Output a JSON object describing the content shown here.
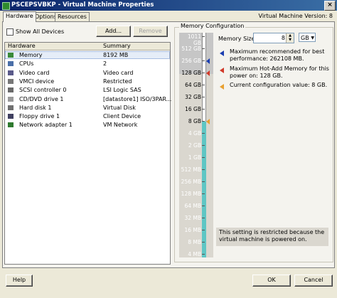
{
  "window": {
    "title": "PSCEPSVBKP - Virtual Machine Properties",
    "close_glyph": "×"
  },
  "tabs": [
    {
      "label": "Hardware"
    },
    {
      "label": "Options"
    },
    {
      "label": "Resources"
    }
  ],
  "version_label": "Virtual Machine Version: 8",
  "hardware": {
    "show_all_devices_label": "Show All Devices",
    "add_label": "Add...",
    "remove_label": "Remove",
    "columns": [
      "Hardware",
      "Summary"
    ],
    "rows": [
      {
        "name": "Memory",
        "summary": "8192 MB",
        "icon": "memory-icon",
        "selected": true
      },
      {
        "name": "CPUs",
        "summary": "2",
        "icon": "cpu-icon"
      },
      {
        "name": "Video card",
        "summary": "Video card",
        "icon": "video-card-icon"
      },
      {
        "name": "VMCI device",
        "summary": "Restricted",
        "icon": "vmci-icon"
      },
      {
        "name": "SCSI controller 0",
        "summary": "LSI Logic SAS",
        "icon": "scsi-icon"
      },
      {
        "name": "CD/DVD drive 1",
        "summary": "[datastore1] ISO/3PAR...",
        "icon": "cd-dvd-icon"
      },
      {
        "name": "Hard disk 1",
        "summary": "Virtual Disk",
        "icon": "hard-disk-icon"
      },
      {
        "name": "Floppy drive 1",
        "summary": "Client Device",
        "icon": "floppy-icon"
      },
      {
        "name": "Network adapter 1",
        "summary": "VM Network",
        "icon": "network-icon"
      }
    ]
  },
  "memory_config": {
    "legend": "Memory Configuration",
    "memory_size_label": "Memory Size:",
    "memory_size_value": "8",
    "unit": "GB",
    "scale_labels": [
      "1011 GB",
      "512 GB",
      "256 GB",
      "128 GB",
      "64 GB",
      "32 GB",
      "16 GB",
      "8 GB",
      "4 GB",
      "2 GB",
      "1 GB",
      "512 MB",
      "256 MB",
      "128 MB",
      "64 MB",
      "32 MB",
      "16 MB",
      "8 MB",
      "4 MB"
    ],
    "current_value_label_index": 7,
    "info": [
      {
        "text": "Maximum recommended for best performance: 262108 MB.",
        "color": "#1a3db0"
      },
      {
        "text": "Maximum Hot-Add Memory for this power on: 128 GB.",
        "color": "#d13a2a"
      },
      {
        "text": "Current configuration value: 8 GB.",
        "color": "#e8a030"
      }
    ],
    "restriction_notice": "This setting is restricted because the virtual machine is powered on."
  },
  "footer": {
    "help_label": "Help",
    "ok_label": "OK",
    "cancel_label": "Cancel"
  }
}
